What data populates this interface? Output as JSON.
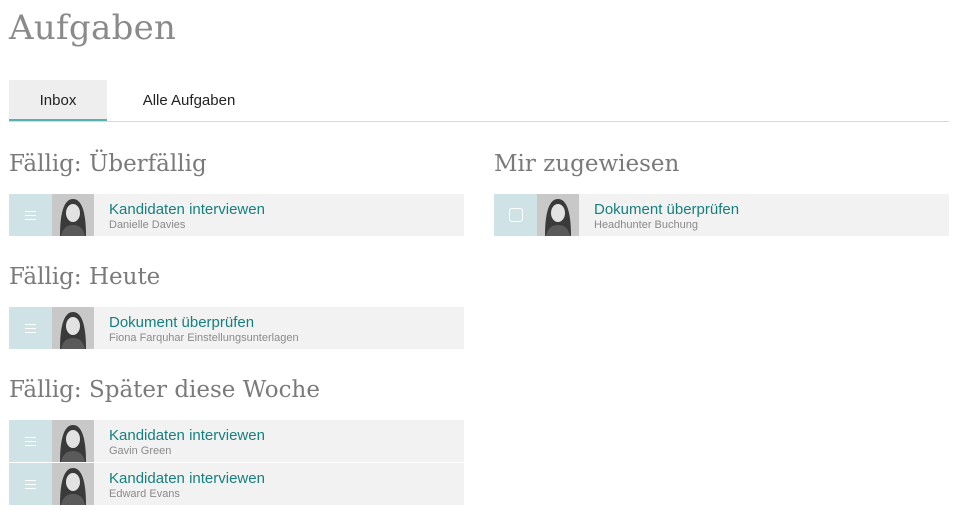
{
  "page": {
    "title": "Aufgaben"
  },
  "tabs": [
    {
      "label": "Inbox",
      "active": true
    },
    {
      "label": "Alle Aufgaben",
      "active": false
    }
  ],
  "sections": {
    "overdue": {
      "title": "Fällig: Überfällig",
      "tasks": [
        {
          "title": "Kandidaten interviewen",
          "subtitle": "Danielle Davies",
          "handle_icon": "drag-handle-icon"
        }
      ]
    },
    "today": {
      "title": "Fällig: Heute",
      "tasks": [
        {
          "title": "Dokument überprüfen",
          "subtitle": "Fiona Farquhar Einstellungsunterlagen",
          "handle_icon": "drag-handle-icon"
        }
      ]
    },
    "later_this_week": {
      "title": "Fällig: Später diese Woche",
      "tasks": [
        {
          "title": "Kandidaten interviewen",
          "subtitle": "Gavin Green",
          "handle_icon": "drag-handle-icon"
        },
        {
          "title": "Kandidaten interviewen",
          "subtitle": "Edward Evans",
          "handle_icon": "drag-handle-icon"
        }
      ]
    },
    "assigned": {
      "title": "Mir zugewiesen",
      "tasks": [
        {
          "title": "Dokument überprüfen",
          "subtitle": "Headhunter Buchung",
          "handle_icon": "checkbox-icon"
        }
      ]
    }
  },
  "colors": {
    "accent": "#16807f",
    "handle_bg": "#cfe3e6",
    "row_bg": "#f2f2f2",
    "tab_underline": "#5ab0b0"
  }
}
